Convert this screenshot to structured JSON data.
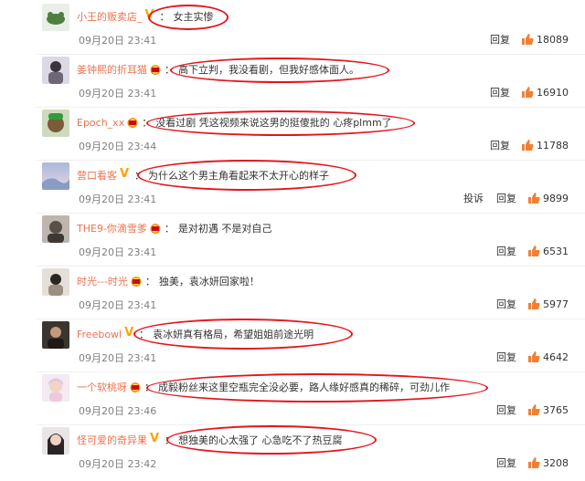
{
  "actions": {
    "report": "投诉",
    "reply": "回复"
  },
  "colors": {
    "username": "#eb7350",
    "highlight": "#e5141c",
    "like": "#f08036"
  },
  "comments": [
    {
      "username": "小王的贩卖店_",
      "badge": "vip",
      "text": "女主实惨",
      "date": "09月20日 23:41",
      "likes": "18089",
      "report": false
    },
    {
      "username": "姜钟熙的折耳猫",
      "badge": "crown",
      "text": "高下立判，我没看剧，但我好感体面人。",
      "date": "09月20日 23:41",
      "likes": "16910",
      "report": false
    },
    {
      "username": "Epoch_xx",
      "badge": "crown",
      "text": "没看过剧 凭这视频来说这男的挺傻批的 心疼plmm了",
      "date": "09月20日 23:44",
      "likes": "11788",
      "report": false
    },
    {
      "username": "营口看客",
      "badge": "vip",
      "text": "为什么这个男主角看起来不太开心的样子",
      "date": "09月20日 23:41",
      "likes": "9899",
      "report": true
    },
    {
      "username": "THE9-你滴雪爹",
      "badge": "crown",
      "text": "是对初遇 不是对自己",
      "date": "09月20日 23:41",
      "likes": "6531",
      "report": false
    },
    {
      "username": "时光---时光",
      "badge": "crown",
      "text": "独美，袁冰妍回家啦！",
      "date": "09月20日 23:41",
      "likes": "5977",
      "report": false
    },
    {
      "username": "Freebowl",
      "badge": "vip",
      "text": "袁冰妍真有格局，希望姐姐前途光明",
      "date": "09月20日 23:41",
      "likes": "4642",
      "report": false
    },
    {
      "username": "一个软桃呀",
      "badge": "crown",
      "text": "成毅粉丝来这里空瓶完全没必要，路人缘好感真的稀碎，可劲儿作",
      "date": "09月20日 23:46",
      "likes": "3765",
      "report": false
    },
    {
      "username": "怪可爱的奇异果",
      "badge": "vip",
      "text": "想独美的心太强了 心急吃不了热豆腐",
      "date": "09月20日 23:42",
      "likes": "3208",
      "report": false
    }
  ]
}
